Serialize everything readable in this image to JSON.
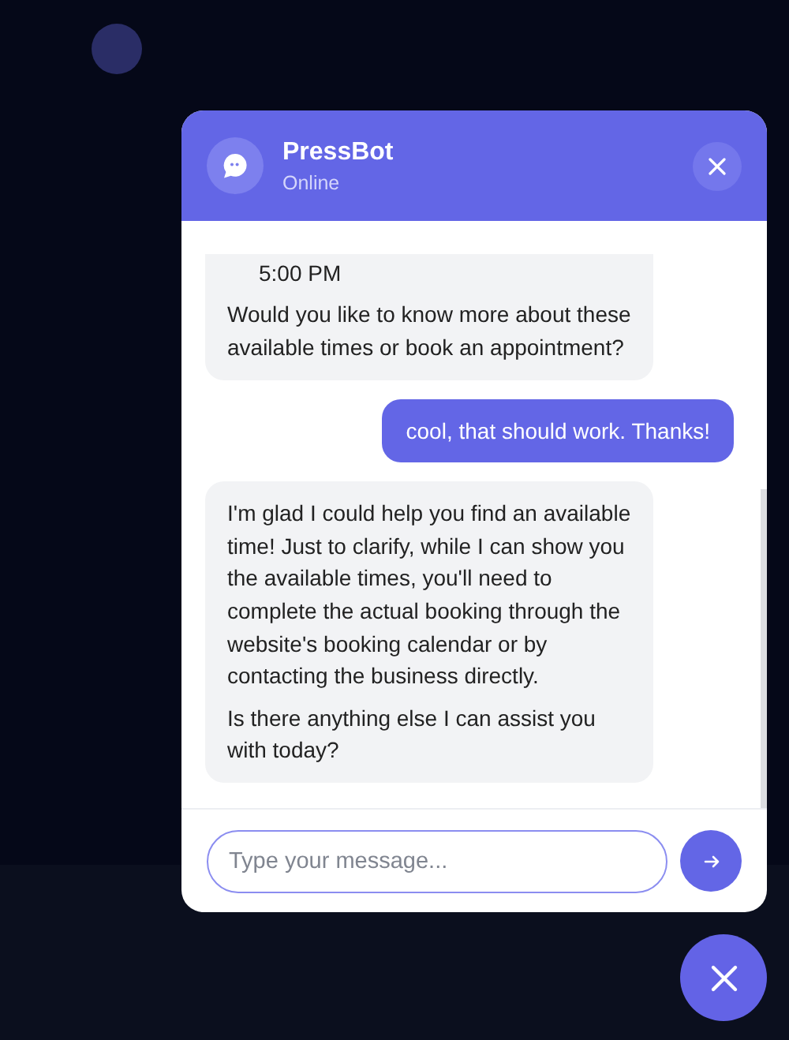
{
  "chat": {
    "title": "PressBot",
    "status": "Online",
    "messages": [
      {
        "kind": "bot",
        "parts": [
          {
            "kind": "indent",
            "text": "5:00 PM"
          },
          {
            "kind": "text",
            "text": "Would you like to know more about these available times or book an appointment?"
          }
        ]
      },
      {
        "kind": "user",
        "parts": [
          {
            "kind": "text",
            "text": "cool, that should work. Thanks!"
          }
        ]
      },
      {
        "kind": "bot",
        "parts": [
          {
            "kind": "text",
            "text": "I'm glad I could help you find an available time! Just to clarify, while I can show you the available times, you'll need to complete the actual booking through the website's booking calendar or by contacting the business directly."
          },
          {
            "kind": "text",
            "text": "Is there anything else I can assist you with today?"
          }
        ]
      }
    ],
    "input": {
      "placeholder": "Type your message..."
    }
  }
}
